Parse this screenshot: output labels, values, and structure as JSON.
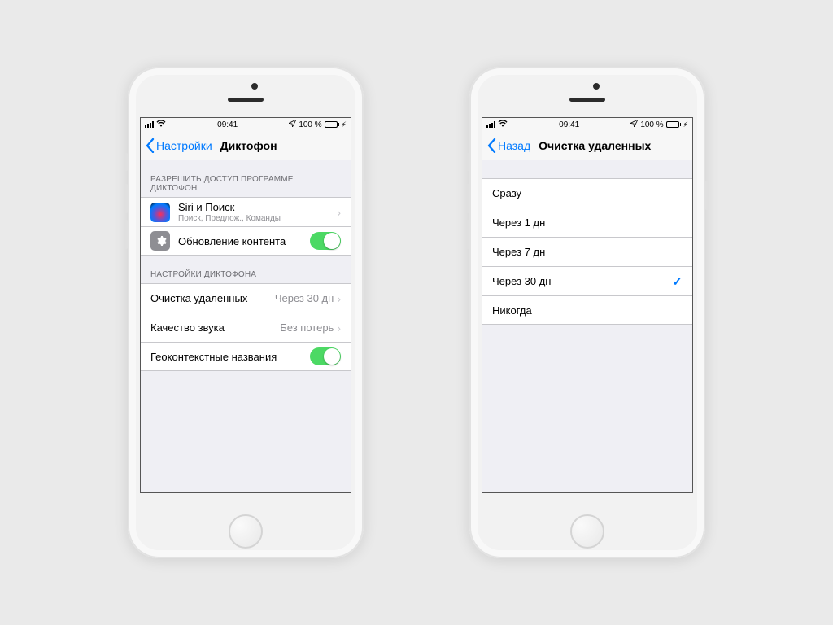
{
  "status": {
    "time": "09:41",
    "battery_pct": "100 %"
  },
  "left": {
    "back_label": "Настройки",
    "title": "Диктофон",
    "section1_header": "РАЗРЕШИТЬ ДОСТУП ПРОГРАММЕ ДИКТОФОН",
    "siri_title": "Siri и Поиск",
    "siri_sub": "Поиск, Предлож., Команды",
    "refresh_label": "Обновление контента",
    "section2_header": "НАСТРОЙКИ ДИКТОФОНА",
    "clear_label": "Очистка удаленных",
    "clear_value": "Через 30 дн",
    "quality_label": "Качество звука",
    "quality_value": "Без потерь",
    "geo_label": "Геоконтекстные названия"
  },
  "right": {
    "back_label": "Назад",
    "title": "Очистка удаленных",
    "options": [
      "Сразу",
      "Через 1 дн",
      "Через 7 дн",
      "Через 30 дн",
      "Никогда"
    ],
    "selected_index": 3
  }
}
